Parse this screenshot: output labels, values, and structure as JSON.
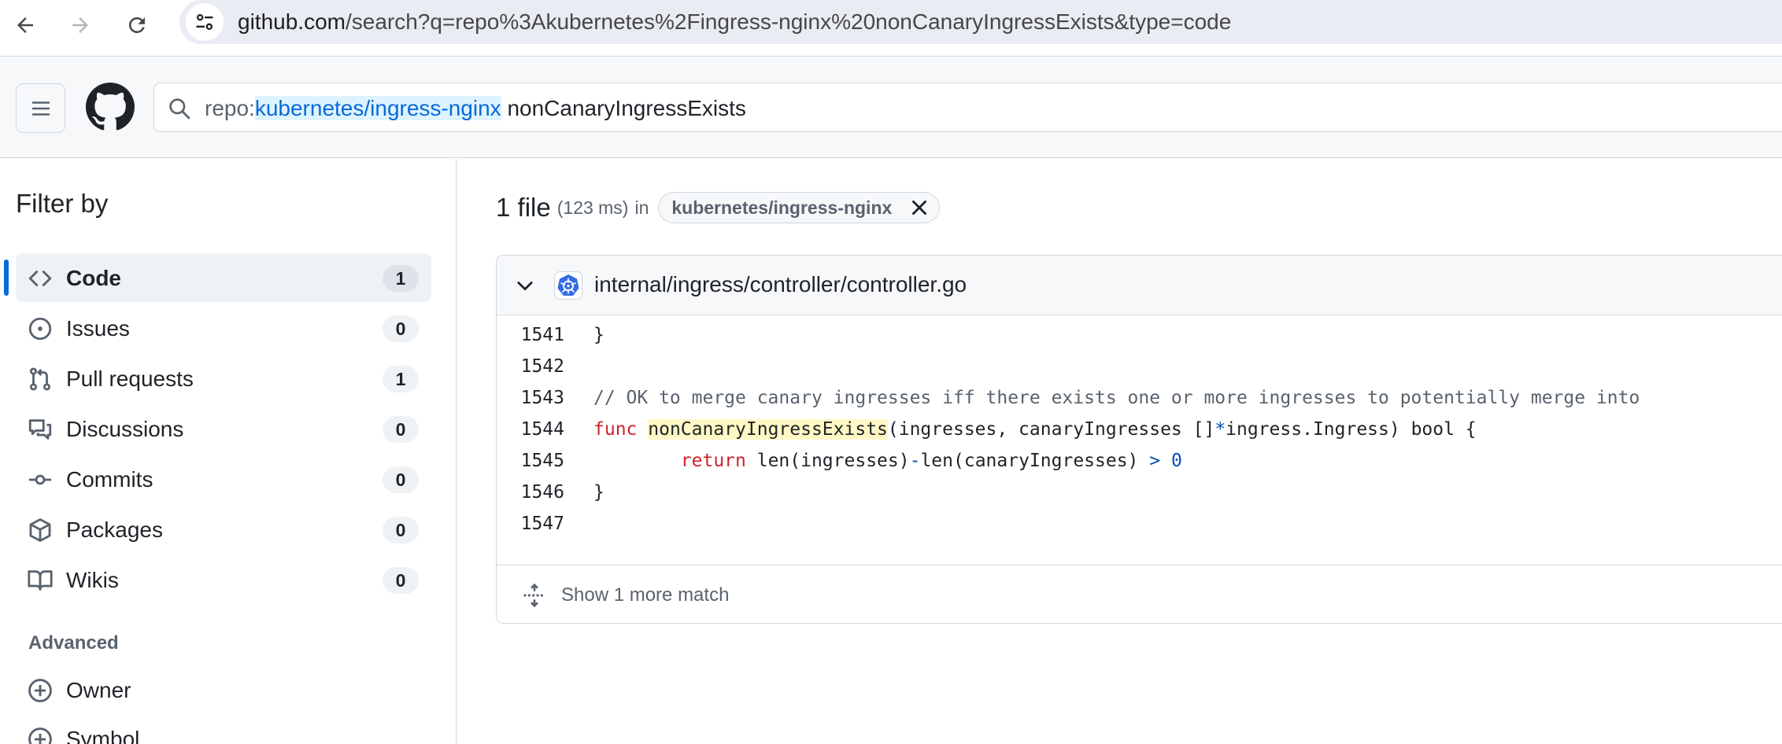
{
  "browser": {
    "url_host": "github.com",
    "url_rest": "/search?q=repo%3Akubernetes%2Fingress-nginx%20nonCanaryIngressExists&type=code"
  },
  "header": {
    "search_qualifier": "repo:",
    "search_repo": "kubernetes/ingress-nginx",
    "search_term": " nonCanaryIngressExists"
  },
  "sidebar": {
    "title": "Filter by",
    "items": [
      {
        "label": "Code",
        "count": "1",
        "icon": "code-icon"
      },
      {
        "label": "Issues",
        "count": "0",
        "icon": "issue-icon"
      },
      {
        "label": "Pull requests",
        "count": "1",
        "icon": "pull-request-icon"
      },
      {
        "label": "Discussions",
        "count": "0",
        "icon": "discussion-icon"
      },
      {
        "label": "Commits",
        "count": "0",
        "icon": "commit-icon"
      },
      {
        "label": "Packages",
        "count": "0",
        "icon": "package-icon"
      },
      {
        "label": "Wikis",
        "count": "0",
        "icon": "book-icon"
      }
    ],
    "advanced_title": "Advanced",
    "advanced_items": [
      {
        "label": "Owner",
        "icon": "plus-circle-icon"
      },
      {
        "label": "Symbol",
        "icon": "plus-circle-icon"
      }
    ]
  },
  "results": {
    "count_label": "1 file",
    "time_label": "(123 ms)",
    "in_label": "in",
    "repo_chip": "kubernetes/ingress-nginx",
    "file_path": "internal/ingress/controller/controller.go",
    "more_match": "Show 1 more match",
    "code": [
      {
        "ln": "1541",
        "parts": [
          {
            "t": "}",
            "c": ""
          }
        ]
      },
      {
        "ln": "1542",
        "parts": []
      },
      {
        "ln": "1543",
        "parts": [
          {
            "t": "// OK to merge canary ingresses iff there exists one or more ingresses to potentially merge into",
            "c": "tok-comment"
          }
        ]
      },
      {
        "ln": "1544",
        "parts": [
          {
            "t": "func",
            "c": "tok-kw"
          },
          {
            "t": " ",
            "c": ""
          },
          {
            "t": "nonCanaryIngressExists",
            "c": "tok-hl"
          },
          {
            "t": "(ingresses, canaryIngresses []",
            "c": ""
          },
          {
            "t": "*",
            "c": "tok-op"
          },
          {
            "t": "ingress.Ingress) bool {",
            "c": ""
          }
        ]
      },
      {
        "ln": "1545",
        "parts": [
          {
            "t": "        ",
            "c": ""
          },
          {
            "t": "return",
            "c": "tok-kw"
          },
          {
            "t": " len(ingresses)",
            "c": ""
          },
          {
            "t": "-",
            "c": "tok-op"
          },
          {
            "t": "len(canaryIngresses) ",
            "c": ""
          },
          {
            "t": ">",
            "c": "tok-op"
          },
          {
            "t": " ",
            "c": ""
          },
          {
            "t": "0",
            "c": "tok-num"
          }
        ]
      },
      {
        "ln": "1546",
        "parts": [
          {
            "t": "}",
            "c": ""
          }
        ]
      },
      {
        "ln": "1547",
        "parts": []
      }
    ]
  },
  "colors": {
    "accent": "#0969da",
    "keyword": "#cf222e",
    "highlight": "#fff8c5"
  }
}
